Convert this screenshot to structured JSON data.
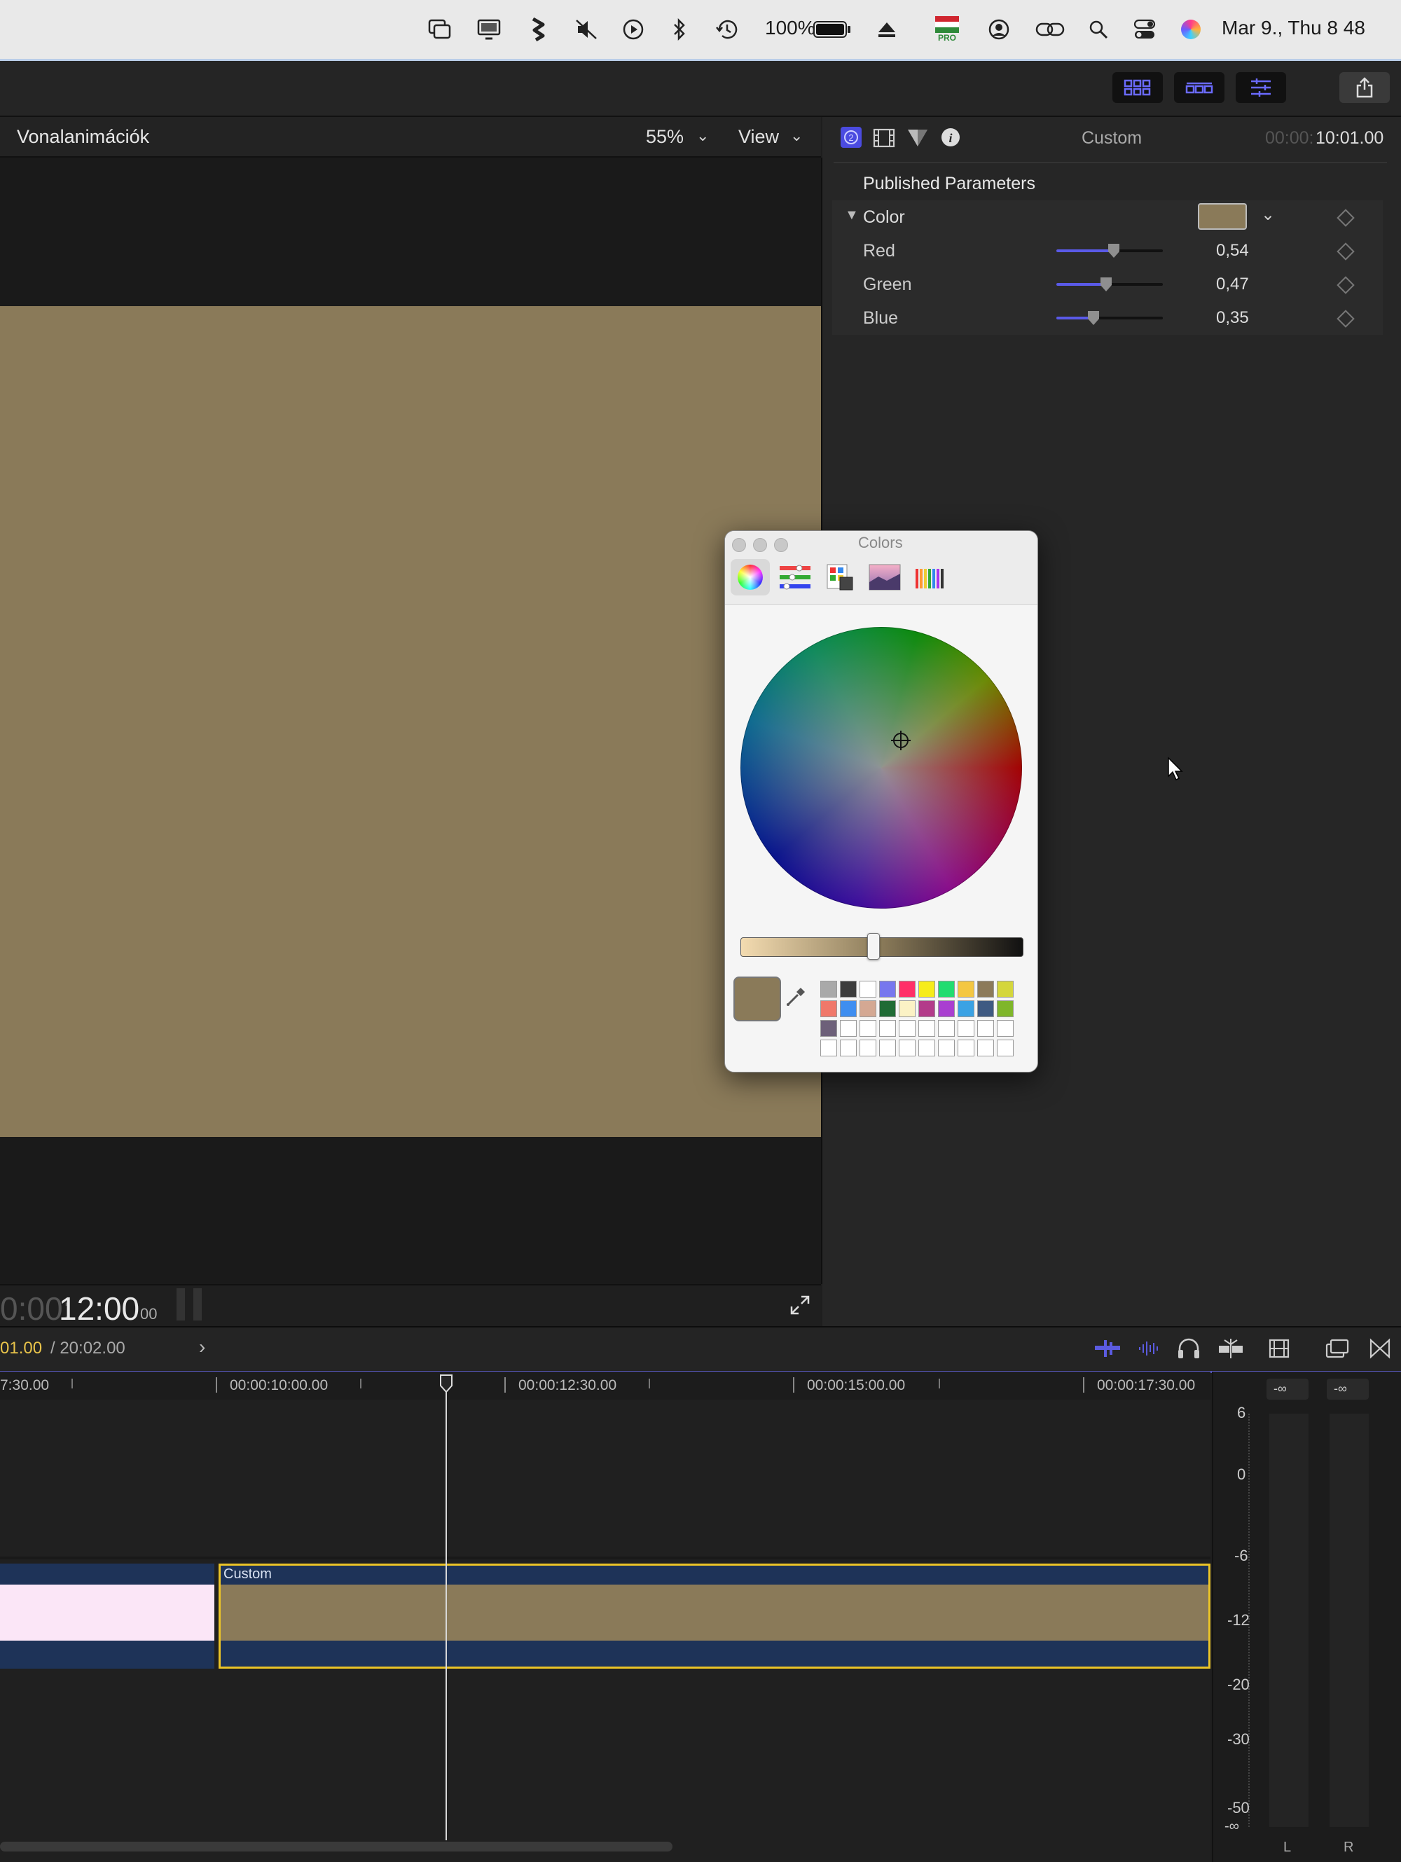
{
  "menubar": {
    "battery": "100%",
    "datetime": "Mar 9., Thu  8 48",
    "flag_badge": "PRO"
  },
  "viewer": {
    "title": "Vonalanimációk",
    "zoom": "55%",
    "view": "View",
    "timecode_dim": "0:00:",
    "timecode_main": "12:00",
    "timecode_frames": "00"
  },
  "inspector": {
    "clip_name": "Custom",
    "duration_dim": "00:00:",
    "duration_main": "10:01.00",
    "section": "Published Parameters",
    "color_label": "Color",
    "color_value": "#8a7a59",
    "params": [
      {
        "label": "Red",
        "value": "0,54",
        "level": 0.54
      },
      {
        "label": "Green",
        "value": "0,47",
        "level": 0.47
      },
      {
        "label": "Blue",
        "value": "0,35",
        "level": 0.35
      }
    ]
  },
  "colors_window": {
    "title": "Colors",
    "current_color": "#8a7a59",
    "brightness": 0.47,
    "swatches_row1": [
      "#a9a9a9",
      "#3d3d3d",
      "#ffffff",
      "#7777ee",
      "#ff2f68",
      "#f6ec1a",
      "#22dc70",
      "#f4c742",
      "#8c7a5a",
      "#d4d63c"
    ],
    "swatches_row2": [
      "#f0786a",
      "#3f8ef0",
      "#d4a893",
      "#1f6b35",
      "#fbf2c5",
      "#b33b8a",
      "#a93fd0",
      "#3aa2e4",
      "#3f5a82",
      "#7fb62a"
    ],
    "swatches_row3": [
      "#6d6079"
    ]
  },
  "timeline": {
    "position_dim": "01.00",
    "position_total": "/ 20:02.00",
    "ruler_labels": [
      "7:30.00",
      "00:00:10:00.00",
      "00:00:12:30.00",
      "00:00:15:00.00",
      "00:00:17:30.00"
    ],
    "clip_name": "Custom",
    "meter_peaks": [
      "-∞",
      "-∞"
    ],
    "meter_scale": [
      "6",
      "0",
      "-6",
      "-12",
      "-20",
      "-30",
      "-50",
      "-∞"
    ],
    "meter_channels": [
      "L",
      "R"
    ]
  }
}
